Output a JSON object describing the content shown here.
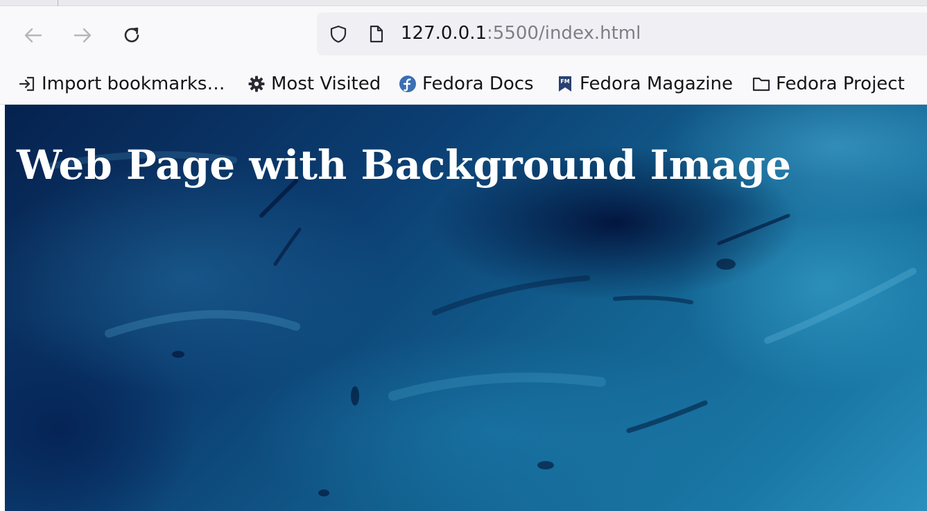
{
  "browser": {
    "url": {
      "host": "127.0.0.1",
      "rest": ":5500/index.html"
    },
    "bookmarks": [
      {
        "label": "Import bookmarks…",
        "icon": "import-icon"
      },
      {
        "label": "Most Visited",
        "icon": "gear-icon"
      },
      {
        "label": "Fedora Docs",
        "icon": "fedora-logo-icon"
      },
      {
        "label": "Fedora Magazine",
        "icon": "fedora-magazine-icon"
      },
      {
        "label": "Fedora Project",
        "icon": "folder-icon"
      }
    ],
    "nav_icons": [
      "back-arrow-icon",
      "forward-arrow-icon",
      "reload-icon"
    ],
    "urlbar_icons": [
      "shield-icon",
      "page-icon"
    ]
  },
  "page": {
    "heading": "Web Page with Background Image",
    "background_colors": [
      "#06224f",
      "#12608e",
      "#2a8fbd"
    ]
  }
}
